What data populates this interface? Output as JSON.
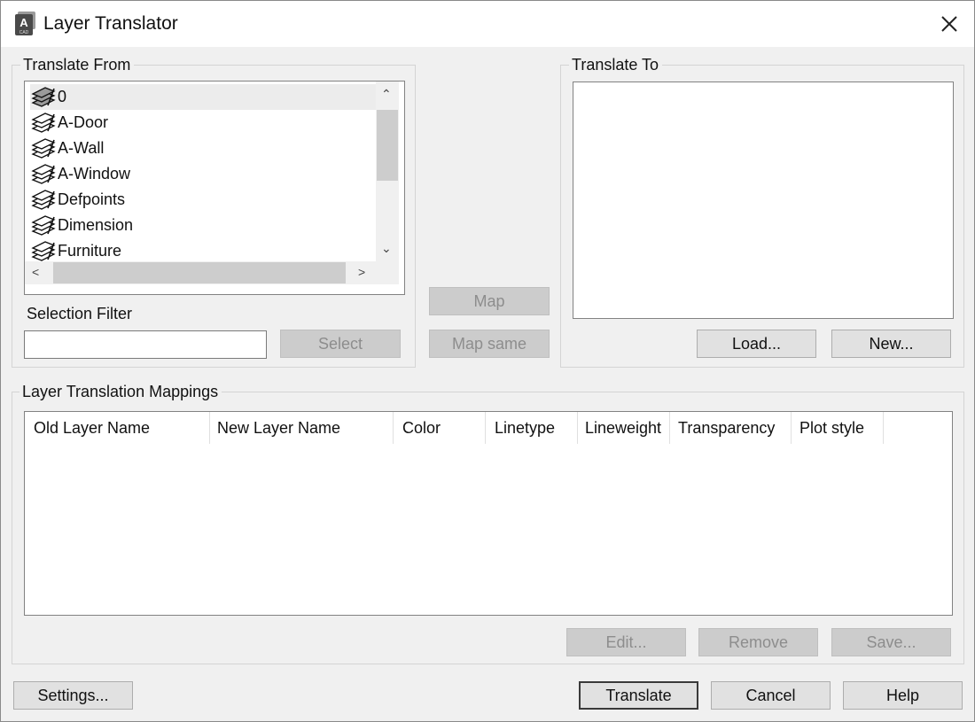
{
  "window": {
    "title": "Layer Translator",
    "icon": "autocad-app-icon",
    "close_icon": "close-icon"
  },
  "translate_from": {
    "label": "Translate From",
    "layers": [
      {
        "name": "0",
        "icon": "layer-stack-icon",
        "selected": true
      },
      {
        "name": "A-Door",
        "icon": "layer-stack-icon"
      },
      {
        "name": "A-Wall",
        "icon": "layer-stack-icon"
      },
      {
        "name": "A-Window",
        "icon": "layer-stack-icon"
      },
      {
        "name": "Defpoints",
        "icon": "layer-stack-icon"
      },
      {
        "name": "Dimension",
        "icon": "layer-stack-icon"
      },
      {
        "name": "Furniture",
        "icon": "layer-stack-icon"
      }
    ],
    "selection_filter_label": "Selection Filter",
    "selection_filter_value": "",
    "select_button": "Select"
  },
  "middle": {
    "map_button": "Map",
    "map_same_button": "Map same"
  },
  "translate_to": {
    "label": "Translate To",
    "load_button": "Load...",
    "new_button": "New..."
  },
  "mappings": {
    "label": "Layer Translation Mappings",
    "columns": [
      "Old Layer Name",
      "New Layer Name",
      "Color",
      "Linetype",
      "Lineweight",
      "Transparency",
      "Plot style"
    ],
    "edit_button": "Edit...",
    "remove_button": "Remove",
    "save_button": "Save..."
  },
  "footer": {
    "settings_button": "Settings...",
    "translate_button": "Translate",
    "cancel_button": "Cancel",
    "help_button": "Help"
  }
}
